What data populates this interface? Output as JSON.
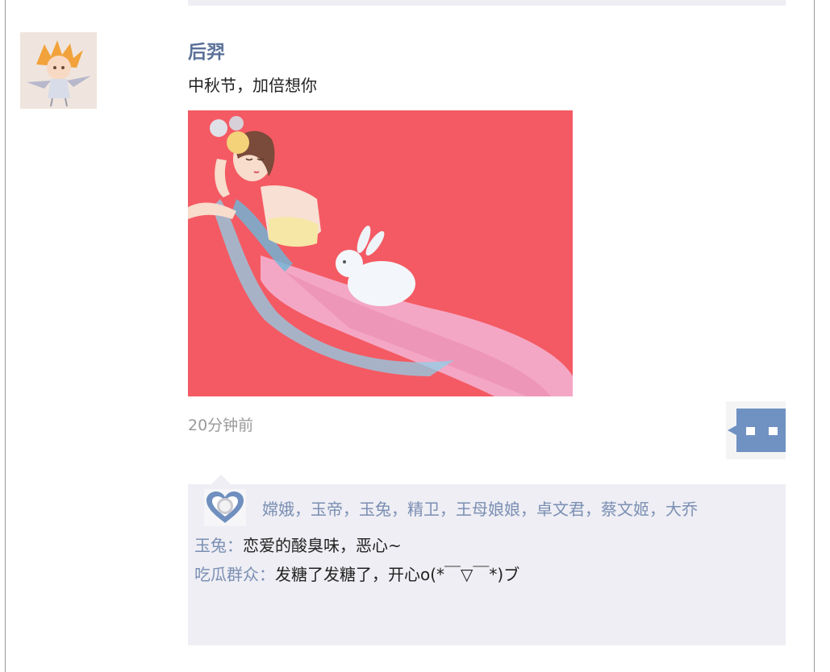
{
  "post": {
    "author": "后羿",
    "text": "中秋节，加倍想你",
    "timestamp": "20分钟前"
  },
  "likes": {
    "names": "嫦娥，玉帝，玉兔，精卫，王母娘娘，卓文君，蔡文姬，大乔"
  },
  "comments": [
    {
      "name": "玉兔",
      "sep": "：",
      "text": "恋爱的酸臭味，恶心~"
    },
    {
      "name": "吃瓜群众",
      "sep": "：",
      "text": "发糖了发糖了，开心o(*￣▽￣*)ブ"
    }
  ],
  "colors": {
    "link_blue": "#5b7199",
    "light_blue": "#7b8fb3",
    "panel_bg": "#eeeef4",
    "image_bg": "#f45a63"
  },
  "icons": {
    "avatar": "cartoon-character-avatar",
    "like": "heart-icon",
    "comment": "comment-bubble-icon"
  }
}
